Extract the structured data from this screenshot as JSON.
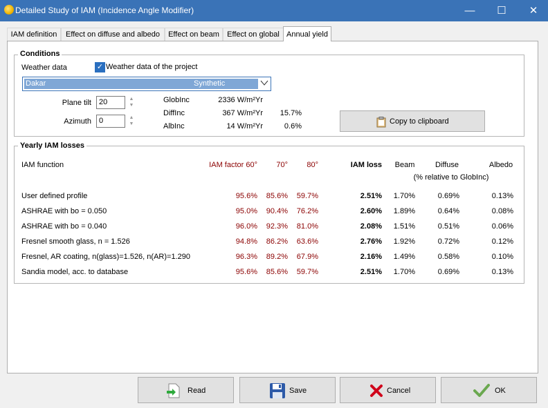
{
  "window": {
    "title": "Detailed Study of IAM (Incidence Angle Modifier)",
    "minimize_glyph": "—",
    "maximize_glyph": "☐",
    "close_glyph": "✕"
  },
  "tabs": [
    {
      "label": "IAM definition"
    },
    {
      "label": "Effect on diffuse and albedo"
    },
    {
      "label": "Effect on beam"
    },
    {
      "label": "Effect on global"
    },
    {
      "label": "Annual yield",
      "active": true
    }
  ],
  "conditions": {
    "title": "Conditions",
    "weather_label": "Weather data",
    "weather_checkbox_label": "Weather data of the project",
    "weather_checkbox_checked": true,
    "combo_site": "Dakar",
    "combo_source": "Synthetic",
    "plane_tilt_label": "Plane tilt",
    "plane_tilt_value": "20",
    "azimuth_label": "Azimuth",
    "azimuth_value": "0",
    "irradiance": [
      {
        "label": "GlobInc",
        "value": "2336 W/m²Yr",
        "pct": ""
      },
      {
        "label": "DiffInc",
        "value": "367 W/m²Yr",
        "pct": "15.7%"
      },
      {
        "label": "AlbInc",
        "value": "14 W/m²Yr",
        "pct": "0.6%"
      }
    ],
    "copy_button": "Copy to clipboard"
  },
  "losses": {
    "title": "Yearly IAM losses",
    "headers": {
      "function": "IAM function",
      "f60": "IAM factor 60°",
      "f70": "70°",
      "f80": "80°",
      "loss": "IAM loss",
      "beam": "Beam",
      "diffuse": "Diffuse",
      "albedo": "Albedo",
      "relative": "(% relative to GlobInc)"
    },
    "rows": [
      {
        "name": "User defined profile",
        "f60": "95.6%",
        "f70": "85.6%",
        "f80": "59.7%",
        "loss": "2.51%",
        "beam": "1.70%",
        "diffuse": "0.69%",
        "albedo": "0.13%"
      },
      {
        "name": "ASHRAE with bo = 0.050",
        "f60": "95.0%",
        "f70": "90.4%",
        "f80": "76.2%",
        "loss": "2.60%",
        "beam": "1.89%",
        "diffuse": "0.64%",
        "albedo": "0.08%"
      },
      {
        "name": "ASHRAE with bo = 0.040",
        "f60": "96.0%",
        "f70": "92.3%",
        "f80": "81.0%",
        "loss": "2.08%",
        "beam": "1.51%",
        "diffuse": "0.51%",
        "albedo": "0.06%"
      },
      {
        "name": "Fresnel smooth glass, n = 1.526",
        "f60": "94.8%",
        "f70": "86.2%",
        "f80": "63.6%",
        "loss": "2.76%",
        "beam": "1.92%",
        "diffuse": "0.72%",
        "albedo": "0.12%"
      },
      {
        "name": "Fresnel, AR coating, n(glass)=1.526, n(AR)=1.290",
        "f60": "96.3%",
        "f70": "89.2%",
        "f80": "67.9%",
        "loss": "2.16%",
        "beam": "1.49%",
        "diffuse": "0.58%",
        "albedo": "0.10%"
      },
      {
        "name": "Sandia model, acc. to database",
        "f60": "95.6%",
        "f70": "85.6%",
        "f80": "59.7%",
        "loss": "2.51%",
        "beam": "1.70%",
        "diffuse": "0.69%",
        "albedo": "0.13%"
      }
    ]
  },
  "buttons": {
    "read": "Read",
    "save": "Save",
    "cancel": "Cancel",
    "ok": "OK"
  },
  "colors": {
    "titlebar": "#3a73b7",
    "factor_text": "#8b0000",
    "ok_check": "#6aa84f",
    "cancel_x": "#d0021b",
    "save_disk": "#2d5aa8"
  }
}
